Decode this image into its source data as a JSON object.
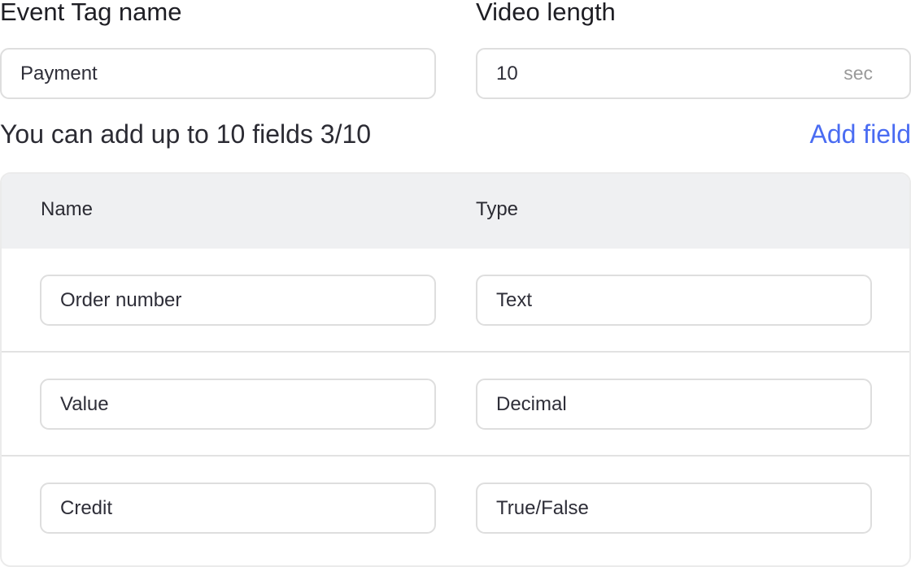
{
  "form": {
    "event_tag_label": "Event Tag name",
    "event_tag_value": "Payment",
    "video_length_label": "Video length",
    "video_length_value": "10",
    "video_length_unit": "sec"
  },
  "fields": {
    "limit_text": "You can add up to 10 fields 3/10",
    "add_field_label": "Add field",
    "columns": {
      "name": "Name",
      "type": "Type"
    },
    "rows": [
      {
        "name": "Order number",
        "type": "Text"
      },
      {
        "name": "Value",
        "type": "Decimal"
      },
      {
        "name": "Credit",
        "type": "True/False"
      }
    ]
  },
  "colors": {
    "accent": "#4a6cf2",
    "header_bg": "#eff0f2",
    "border": "#dedede"
  }
}
